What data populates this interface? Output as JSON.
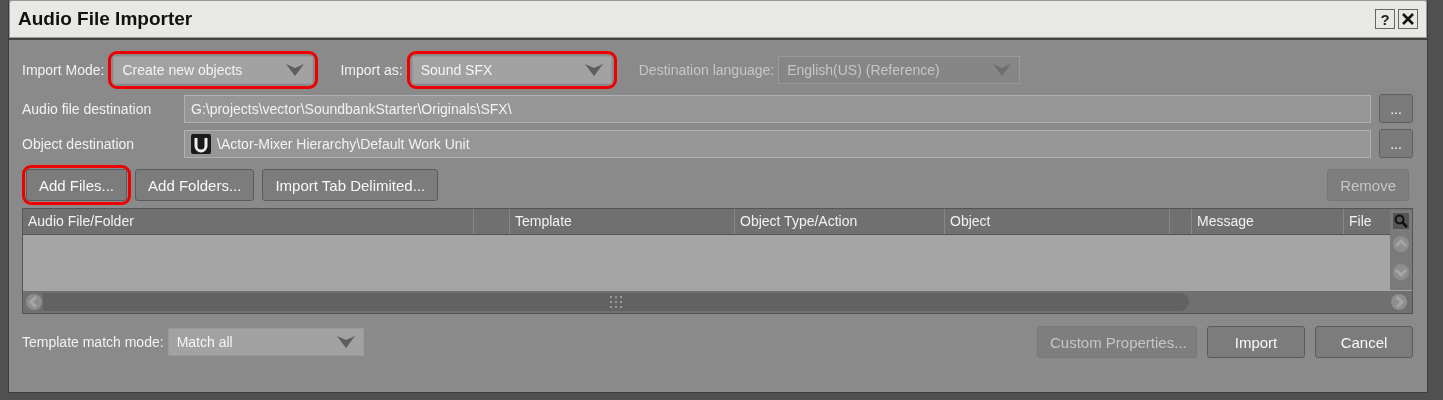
{
  "window": {
    "title": "Audio File Importer",
    "help": "?"
  },
  "import_mode": {
    "label": "Import Mode:",
    "value": "Create new objects",
    "highlighted": true
  },
  "import_as": {
    "label": "Import as:",
    "value": "Sound SFX",
    "highlighted": true
  },
  "destination_language": {
    "label": "Destination language:",
    "value": "English(US) (Reference)",
    "disabled": true
  },
  "destinations": [
    {
      "label": "Audio file destination",
      "value": "G:\\projects\\vector\\SoundbankStarter\\Originals\\SFX\\",
      "kind": "path",
      "browse": "..."
    },
    {
      "label": "Object destination",
      "value": "\\Actor-Mixer Hierarchy\\Default Work Unit",
      "kind": "object",
      "browse": "..."
    }
  ],
  "buttons": [
    {
      "label": "Add Files...",
      "highlighted": true,
      "disabled": false
    },
    {
      "label": "Add Folders...",
      "highlighted": false,
      "disabled": false
    },
    {
      "label": "Import Tab Delimited...",
      "highlighted": false,
      "disabled": false
    },
    {
      "label": "Remove",
      "highlighted": false,
      "disabled": true
    }
  ],
  "table": {
    "columns": [
      "Audio File/Folder",
      "Template",
      "Object Type/Action",
      "Object",
      "Message",
      "File"
    ]
  },
  "template_match_mode": {
    "label": "Template match mode:",
    "value": "Match all"
  },
  "footer_buttons": [
    {
      "label": "Custom Properties...",
      "disabled": true
    },
    {
      "label": "Import",
      "disabled": false
    },
    {
      "label": "Cancel",
      "disabled": false
    }
  ]
}
